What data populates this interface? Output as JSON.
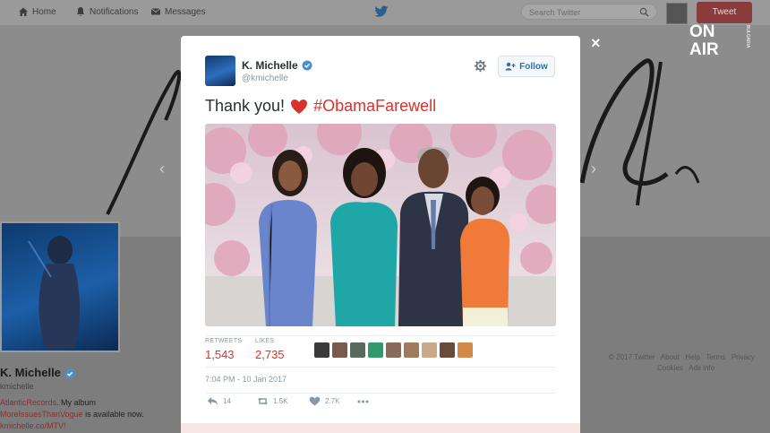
{
  "topbar": {
    "nav": [
      {
        "label": "Home",
        "icon": "home-icon"
      },
      {
        "label": "Notifications",
        "icon": "bell-icon"
      },
      {
        "label": "Messages",
        "icon": "envelope-icon"
      }
    ],
    "search_placeholder": "Search Twitter",
    "tweet_button": "Tweet"
  },
  "profile": {
    "name": "K. Michelle",
    "handle": "kmichelle",
    "bio_parts": [
      "AtlanticRecords",
      ". My album",
      "MoreIssuesThanVogue",
      " is available now.",
      "kmichelle.co/MTV!"
    ]
  },
  "footer": {
    "links": [
      "© 2017 Twitter",
      "About",
      "Help",
      "Terms",
      "Privacy",
      "Cookies",
      "Ads info"
    ]
  },
  "watermark": {
    "line1": "ON",
    "line2": "AIR",
    "side": "BULGARIA"
  },
  "tweet": {
    "author_name": "K. Michelle",
    "author_handle": "@kmichelle",
    "follow_label": "Follow",
    "text": "Thank you!",
    "hashtag": "#ObamaFarewell",
    "retweets_label": "RETWEETS",
    "retweets": "1,543",
    "likes_label": "LIKES",
    "likes": "2,735",
    "timestamp": "7:04 PM - 10 Jan 2017",
    "reply_count": "14",
    "retweet_count": "1.5K",
    "like_count": "2.7K"
  },
  "colors": {
    "accent": "#d9322c",
    "link": "#2f6fa8",
    "muted": "#8899a6",
    "overlay": "#7d7d7d"
  },
  "close_symbol": "×",
  "arrows": {
    "left": "‹",
    "right": "›"
  }
}
